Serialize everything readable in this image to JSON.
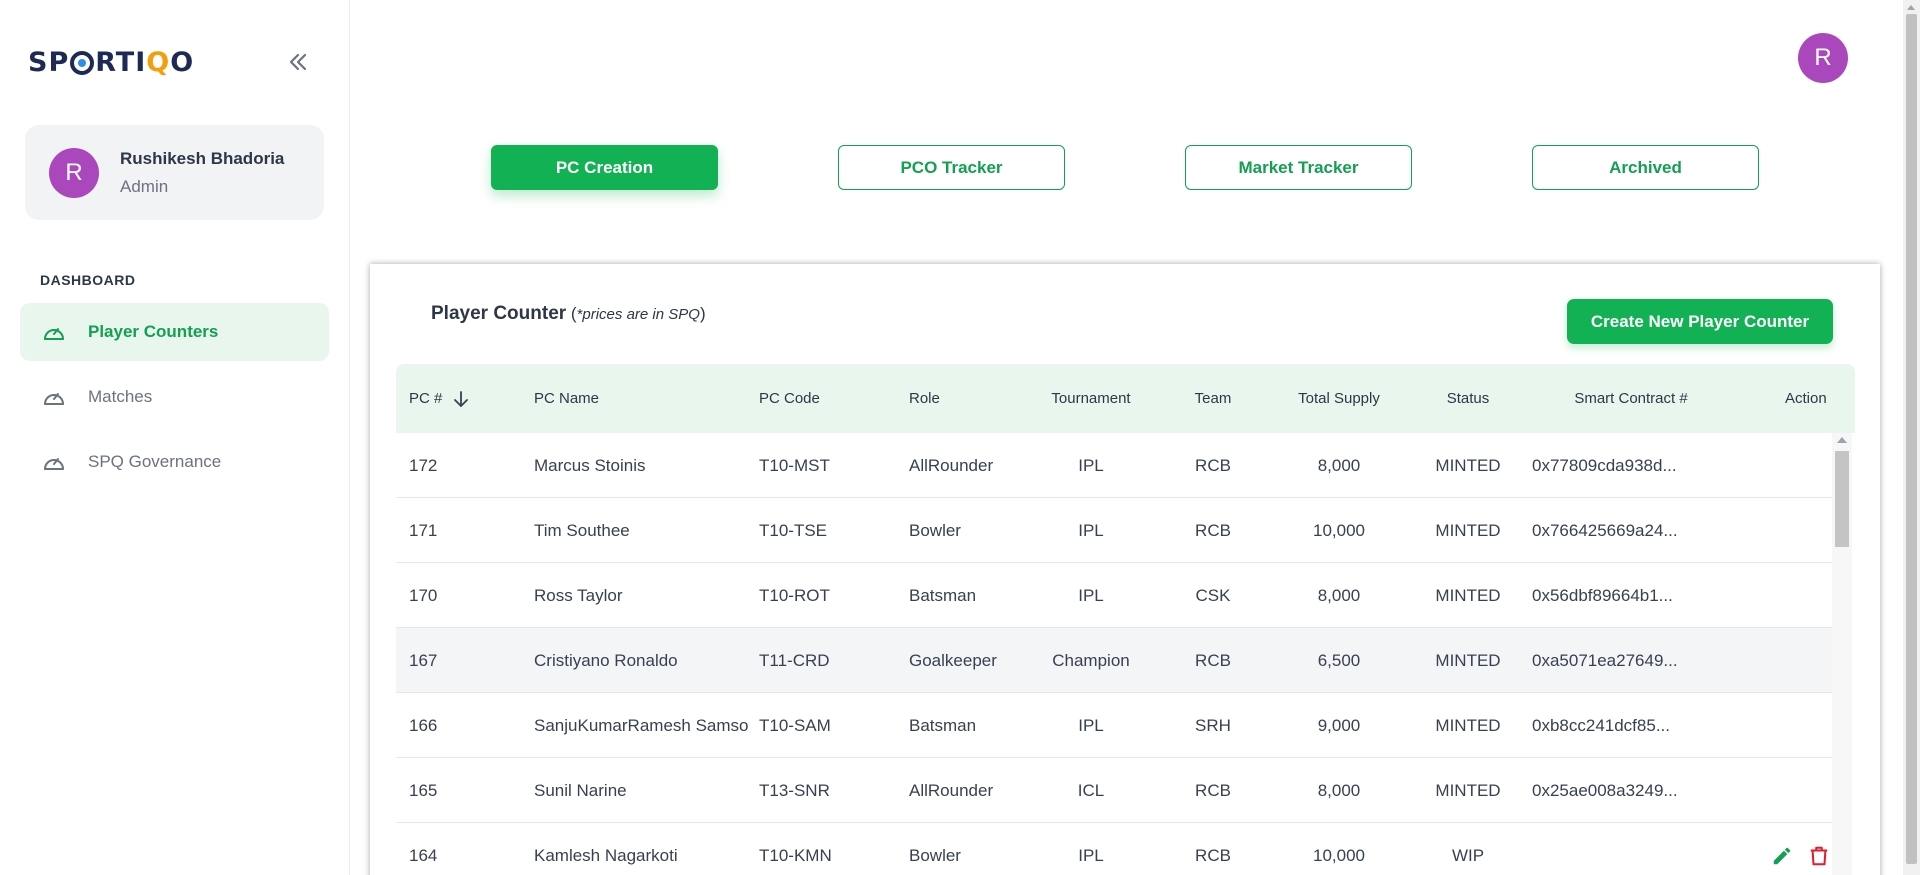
{
  "brand": {
    "logo_parts": [
      "SP",
      "RTI",
      "Q",
      "O"
    ],
    "accent_color": "#12b254",
    "avatar_color": "#ab47bc"
  },
  "user": {
    "initial": "R",
    "name": "Rushikesh Bhadoria",
    "role": "Admin"
  },
  "sidebar": {
    "section_label": "DASHBOARD",
    "items": [
      {
        "label": "Player Counters",
        "icon": "speedometer-icon",
        "active": true
      },
      {
        "label": "Matches",
        "icon": "speedometer-icon",
        "active": false
      },
      {
        "label": "SPQ Governance",
        "icon": "speedometer-icon",
        "active": false
      }
    ]
  },
  "tabs": [
    {
      "label": "PC Creation",
      "active": true
    },
    {
      "label": "PCO Tracker",
      "active": false
    },
    {
      "label": "Market Tracker",
      "active": false
    },
    {
      "label": "Archived",
      "active": false
    }
  ],
  "card": {
    "title": "Player Counter",
    "note_open": " (",
    "note_text": "*prices are in SPQ",
    "note_close": ")",
    "create_button": "Create New Player Counter"
  },
  "table": {
    "headers": [
      "PC #",
      "PC Name",
      "PC Code",
      "Role",
      "Tournament",
      "Team",
      "Total Supply",
      "Status",
      "Smart Contract #",
      "Action"
    ],
    "rows": [
      [
        "172",
        "Marcus Stoinis",
        "T10-MST",
        "AllRounder",
        "IPL",
        "RCB",
        "8,000",
        "MINTED",
        "0x77809cda938d..."
      ],
      [
        "171",
        "Tim Southee",
        "T10-TSE",
        "Bowler",
        "IPL",
        "RCB",
        "10,000",
        "MINTED",
        "0x766425669a24..."
      ],
      [
        "170",
        "Ross Taylor",
        "T10-ROT",
        "Batsman",
        "IPL",
        "CSK",
        "8,000",
        "MINTED",
        "0x56dbf89664b1..."
      ],
      [
        "167",
        "Cristiyano Ronaldo",
        "T11-CRD",
        "Goalkeeper",
        "Champion",
        "RCB",
        "6,500",
        "MINTED",
        "0xa5071ea27649..."
      ],
      [
        "166",
        "SanjuKumarRamesh Samson",
        "T10-SAM",
        "Batsman",
        "IPL",
        "SRH",
        "9,000",
        "MINTED",
        "0xb8cc241dcf85..."
      ],
      [
        "165",
        "Sunil Narine",
        "T13-SNR",
        "AllRounder",
        "ICL",
        "RCB",
        "8,000",
        "MINTED",
        "0x25ae008a3249..."
      ],
      [
        "164",
        "Kamlesh Nagarkoti",
        "T10-KMN",
        "Bowler",
        "IPL",
        "RCB",
        "10,000",
        "WIP",
        ""
      ]
    ]
  },
  "icons": {
    "collapse": "double-chevron-left-icon",
    "sort": "arrow-down-icon",
    "edit": "pencil-icon",
    "delete": "trash-icon"
  }
}
